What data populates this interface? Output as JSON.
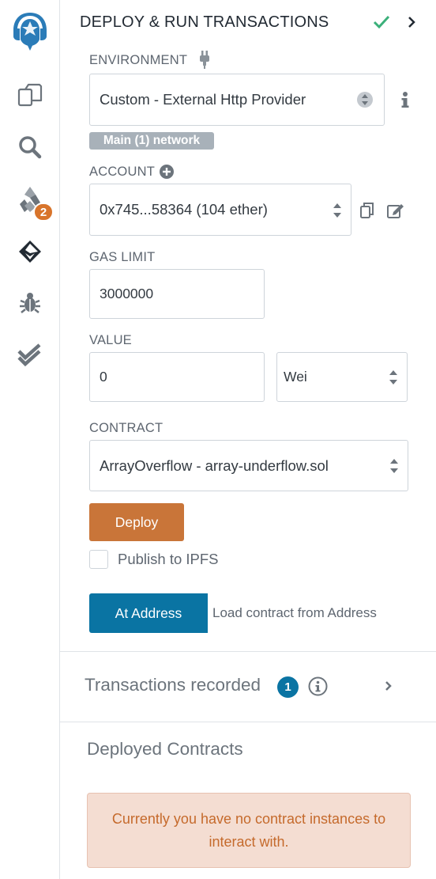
{
  "iconbar": {
    "items": [
      {
        "icon": "remix-logo-icon"
      },
      {
        "icon": "file-explorer-icon"
      },
      {
        "icon": "search-icon"
      },
      {
        "icon": "solidity-compiler-icon",
        "badge": "2"
      },
      {
        "icon": "deploy-run-icon"
      },
      {
        "icon": "debugger-icon"
      },
      {
        "icon": "unit-testing-icon"
      }
    ]
  },
  "panel": {
    "title": "DEPLOY & RUN TRANSACTIONS",
    "environment": {
      "label": "ENVIRONMENT",
      "selected": "Custom - External Http Provider",
      "network": "Main (1) network"
    },
    "account": {
      "label": "ACCOUNT",
      "selected": "0x745...58364 (104 ether)"
    },
    "gas_limit": {
      "label": "GAS LIMIT",
      "value": "3000000"
    },
    "value": {
      "label": "VALUE",
      "amount": "0",
      "unit": "Wei"
    },
    "contract": {
      "label": "CONTRACT",
      "selected": "ArrayOverflow - array-underflow.sol"
    },
    "deploy_label": "Deploy",
    "publish_label": "Publish to IPFS",
    "at_address": {
      "button": "At Address",
      "placeholder": "Load contract from Address"
    },
    "transactions": {
      "title": "Transactions recorded",
      "count": "1"
    },
    "deployed": {
      "title": "Deployed Contracts",
      "empty_message": "Currently you have no contract instances to interact with."
    }
  },
  "colors": {
    "accent_blue": "#0a74a3",
    "deploy_orange": "#c97539",
    "success_green": "#3bb07a",
    "alert_bg": "#f4ddd2",
    "alert_text": "#c56a2c"
  }
}
